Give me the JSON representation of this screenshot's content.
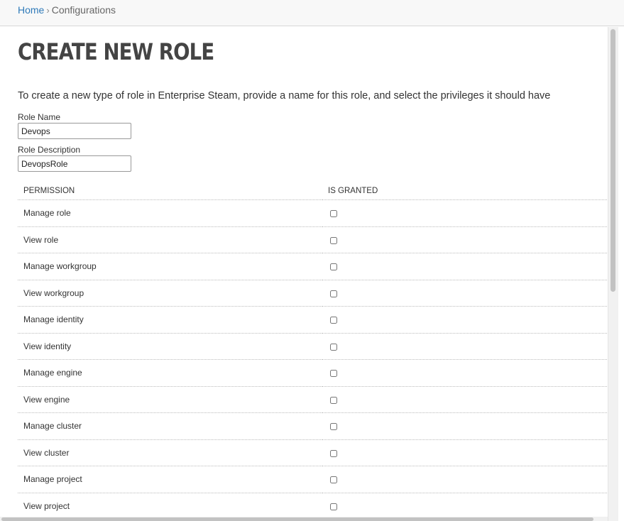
{
  "breadcrumb": {
    "home": "Home",
    "separator": "›",
    "current": "Configurations"
  },
  "page": {
    "title": "CREATE NEW ROLE",
    "intro": "To create a new type of role in Enterprise Steam, provide a name for this role, and select the privileges it should have"
  },
  "form": {
    "role_name_label": "Role Name",
    "role_name_value": "Devops",
    "role_description_label": "Role Description",
    "role_description_value": "DevopsRole"
  },
  "table": {
    "headers": {
      "permission": "PERMISSION",
      "is_granted": "IS GRANTED"
    },
    "rows": [
      {
        "permission": "Manage role",
        "granted": false
      },
      {
        "permission": "View role",
        "granted": false
      },
      {
        "permission": "Manage workgroup",
        "granted": false
      },
      {
        "permission": "View workgroup",
        "granted": false
      },
      {
        "permission": "Manage identity",
        "granted": false
      },
      {
        "permission": "View identity",
        "granted": false
      },
      {
        "permission": "Manage engine",
        "granted": false
      },
      {
        "permission": "View engine",
        "granted": false
      },
      {
        "permission": "Manage cluster",
        "granted": false
      },
      {
        "permission": "View cluster",
        "granted": false
      },
      {
        "permission": "Manage project",
        "granted": false
      },
      {
        "permission": "View project",
        "granted": false
      }
    ]
  }
}
